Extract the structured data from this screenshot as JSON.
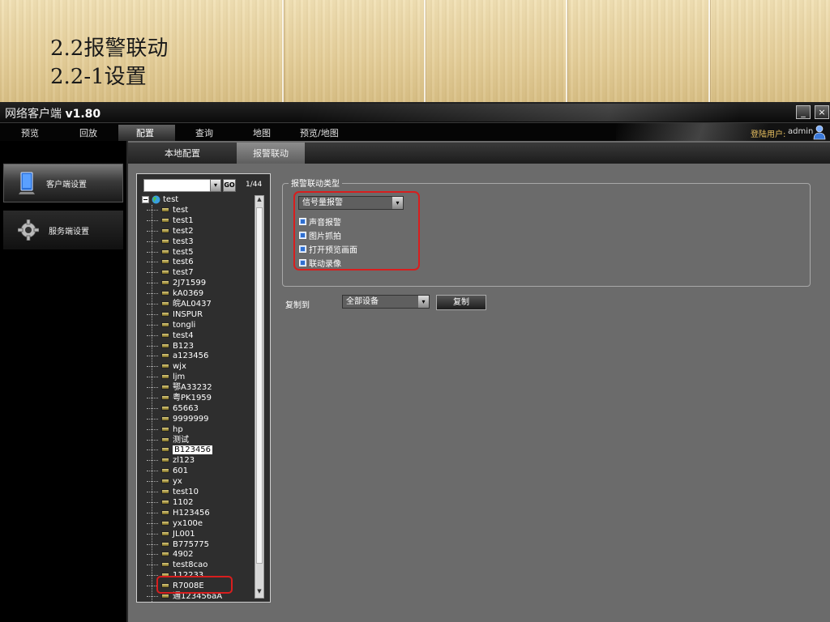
{
  "slide": {
    "heading_line1": "2.2报警联动",
    "heading_line2": "2.2-1设置"
  },
  "app": {
    "title_prefix": "网络客户端 ",
    "title_version": "v1.80",
    "minimize_label": "_",
    "close_label": "×"
  },
  "menu": {
    "items": [
      "预览",
      "回放",
      "配置",
      "查询",
      "地图",
      "预览/地图"
    ],
    "active": "配置",
    "user_label": "登陆用户:",
    "user_name": "admin"
  },
  "leftnav": {
    "items": [
      {
        "label": "客户端设置",
        "icon": "monitor-icon"
      },
      {
        "label": "服务端设置",
        "icon": "gear-icon"
      }
    ]
  },
  "tabs": [
    "本地配置",
    "报警联动"
  ],
  "tree": {
    "search_value": "",
    "go_label": "GO",
    "drop_arrow": "▾",
    "page_count": "1/44",
    "root_label": "test",
    "selected": "B123456",
    "scroll_up": "▲",
    "scroll_down": "▼",
    "devices": [
      "test",
      "test1",
      "test2",
      "test3",
      "test5",
      "test6",
      "test7",
      "2J71599",
      "kA0369",
      "皖AL0437",
      "INSPUR",
      "tongli",
      "test4",
      "B123",
      "a123456",
      "wjx",
      "ljm",
      "鄂A33232",
      "粤PK1959",
      "65663",
      "9999999",
      "hp",
      "测试",
      "B123456",
      "zl123",
      "601",
      "yx",
      "test10",
      "1102",
      "H123456",
      "yx100e",
      "JL001",
      "B775775",
      "4902",
      "test8cao",
      "112233",
      "R7008E",
      "通123456aA"
    ]
  },
  "alarm": {
    "legend": "报警联动类型",
    "type_value": "信号量报警",
    "drop_arrow": "▾",
    "options": [
      "声音报警",
      "图片抓拍",
      "打开预览画面",
      "联动录像"
    ]
  },
  "copy": {
    "label": "复制到",
    "target_value": "全部设备",
    "drop_arrow": "▾",
    "button_label": "复制"
  },
  "colors": {
    "highlight": "#d81e1e",
    "checkbox": "#2f6fcf",
    "panel_bg": "#6b6b6b"
  }
}
